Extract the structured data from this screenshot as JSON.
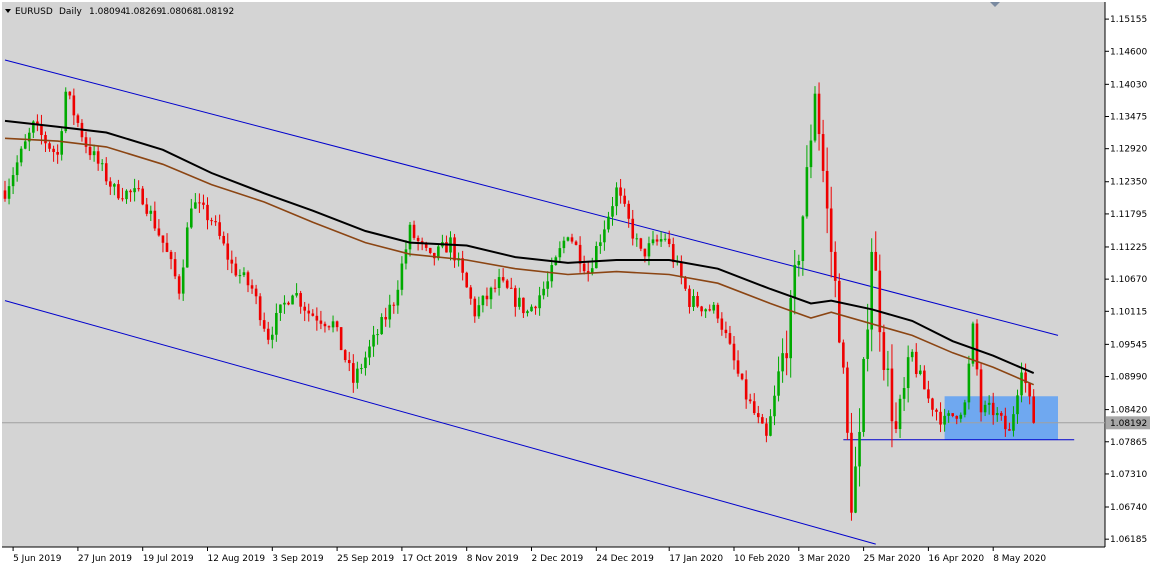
{
  "chart_data": {
    "type": "candlestick",
    "symbol": "EURUSD",
    "timeframe": "Daily",
    "ohlc_last": {
      "open": "1.08094",
      "high": "1.08269",
      "low": "1.08068",
      "close": "1.08192"
    },
    "current_price_label": "1.08192",
    "current_price": 1.08192,
    "ylim": [
      1.0605,
      1.1545
    ],
    "yticks": [
      "1.15155",
      "1.14600",
      "1.14030",
      "1.13475",
      "1.12920",
      "1.12350",
      "1.11795",
      "1.11225",
      "1.10670",
      "1.10115",
      "1.09545",
      "1.08990",
      "1.08420",
      "1.07865",
      "1.07310",
      "1.06740",
      "1.06185"
    ],
    "xticks": [
      {
        "label": "5 Jun 2019",
        "date": "2019-06-05"
      },
      {
        "label": "27 Jun 2019",
        "date": "2019-06-27"
      },
      {
        "label": "19 Jul 2019",
        "date": "2019-07-19"
      },
      {
        "label": "12 Aug 2019",
        "date": "2019-08-12"
      },
      {
        "label": "3 Sep 2019",
        "date": "2019-09-03"
      },
      {
        "label": "25 Sep 2019",
        "date": "2019-09-25"
      },
      {
        "label": "17 Oct 2019",
        "date": "2019-10-17"
      },
      {
        "label": "8 Nov 2019",
        "date": "2019-11-08"
      },
      {
        "label": "2 Dec 2019",
        "date": "2019-12-02"
      },
      {
        "label": "24 Dec 2019",
        "date": "2019-12-24"
      },
      {
        "label": "17 Jan 2020",
        "date": "2020-01-17"
      },
      {
        "label": "10 Feb 2020",
        "date": "2020-02-10"
      },
      {
        "label": "3 Mar 2020",
        "date": "2020-03-03"
      },
      {
        "label": "25 Mar 2020",
        "date": "2020-03-25"
      },
      {
        "label": "16 Apr 2020",
        "date": "2020-04-16"
      },
      {
        "label": "8 May 2020",
        "date": "2020-05-08"
      }
    ],
    "close_path": [
      [
        "2019-06-03",
        1.122
      ],
      [
        "2019-06-12",
        1.133
      ],
      [
        "2019-06-20",
        1.128
      ],
      [
        "2019-06-24",
        1.139
      ],
      [
        "2019-07-01",
        1.13
      ],
      [
        "2019-07-10",
        1.122
      ],
      [
        "2019-07-19",
        1.121
      ],
      [
        "2019-07-26",
        1.113
      ],
      [
        "2019-08-01",
        1.105
      ],
      [
        "2019-08-06",
        1.12
      ],
      [
        "2019-08-13",
        1.117
      ],
      [
        "2019-08-20",
        1.109
      ],
      [
        "2019-08-27",
        1.105
      ],
      [
        "2019-09-02",
        1.097
      ],
      [
        "2019-09-10",
        1.105
      ],
      [
        "2019-09-16",
        1.101
      ],
      [
        "2019-09-24",
        1.099
      ],
      [
        "2019-10-01",
        1.089
      ],
      [
        "2019-10-08",
        1.096
      ],
      [
        "2019-10-15",
        1.103
      ],
      [
        "2019-10-21",
        1.115
      ],
      [
        "2019-10-28",
        1.11
      ],
      [
        "2019-11-04",
        1.113
      ],
      [
        "2019-11-12",
        1.101
      ],
      [
        "2019-11-20",
        1.106
      ],
      [
        "2019-11-29",
        1.101
      ],
      [
        "2019-12-06",
        1.106
      ],
      [
        "2019-12-13",
        1.115
      ],
      [
        "2019-12-20",
        1.108
      ],
      [
        "2019-12-31",
        1.122
      ],
      [
        "2020-01-08",
        1.111
      ],
      [
        "2020-01-16",
        1.114
      ],
      [
        "2020-01-24",
        1.103
      ],
      [
        "2020-02-04",
        1.101
      ],
      [
        "2020-02-12",
        1.088
      ],
      [
        "2020-02-20",
        1.079
      ],
      [
        "2020-02-28",
        1.1
      ],
      [
        "2020-03-05",
        1.124
      ],
      [
        "2020-03-09",
        1.14
      ],
      [
        "2020-03-12",
        1.118
      ],
      [
        "2020-03-17",
        1.099
      ],
      [
        "2020-03-20",
        1.069
      ],
      [
        "2020-03-24",
        1.078
      ],
      [
        "2020-03-27",
        1.113
      ],
      [
        "2020-04-01",
        1.094
      ],
      [
        "2020-04-06",
        1.08
      ],
      [
        "2020-04-10",
        1.093
      ],
      [
        "2020-04-16",
        1.086
      ],
      [
        "2020-04-22",
        1.082
      ],
      [
        "2020-04-29",
        1.085
      ],
      [
        "2020-05-01",
        1.098
      ],
      [
        "2020-05-05",
        1.084
      ],
      [
        "2020-05-08",
        1.084
      ],
      [
        "2020-05-14",
        1.08
      ],
      [
        "2020-05-19",
        1.092
      ],
      [
        "2020-05-22",
        1.0819
      ]
    ],
    "series": [
      {
        "kind": "moving-average",
        "color": "#000000",
        "values": [
          [
            "2019-06-03",
            1.134
          ],
          [
            "2019-06-20",
            1.133
          ],
          [
            "2019-07-08",
            1.132
          ],
          [
            "2019-07-26",
            1.129
          ],
          [
            "2019-08-13",
            1.125
          ],
          [
            "2019-08-30",
            1.1215
          ],
          [
            "2019-09-17",
            1.1185
          ],
          [
            "2019-10-04",
            1.115
          ],
          [
            "2019-10-21",
            1.113
          ],
          [
            "2019-11-08",
            1.1125
          ],
          [
            "2019-11-26",
            1.1105
          ],
          [
            "2019-12-13",
            1.1095
          ],
          [
            "2019-12-31",
            1.11
          ],
          [
            "2020-01-17",
            1.11
          ],
          [
            "2020-02-04",
            1.1085
          ],
          [
            "2020-02-21",
            1.105
          ],
          [
            "2020-03-06",
            1.1025
          ],
          [
            "2020-03-13",
            1.103
          ],
          [
            "2020-03-27",
            1.1015
          ],
          [
            "2020-04-10",
            1.0995
          ],
          [
            "2020-04-24",
            1.096
          ],
          [
            "2020-05-08",
            1.0935
          ],
          [
            "2020-05-22",
            1.0905
          ]
        ]
      },
      {
        "kind": "moving-average",
        "color": "#8b4513",
        "values": [
          [
            "2019-06-03",
            1.131
          ],
          [
            "2019-06-20",
            1.1305
          ],
          [
            "2019-07-08",
            1.1295
          ],
          [
            "2019-07-26",
            1.1265
          ],
          [
            "2019-08-13",
            1.123
          ],
          [
            "2019-08-30",
            1.12
          ],
          [
            "2019-09-17",
            1.1165
          ],
          [
            "2019-10-04",
            1.113
          ],
          [
            "2019-10-21",
            1.111
          ],
          [
            "2019-11-08",
            1.11
          ],
          [
            "2019-11-26",
            1.1085
          ],
          [
            "2019-12-13",
            1.1075
          ],
          [
            "2019-12-31",
            1.108
          ],
          [
            "2020-01-17",
            1.1075
          ],
          [
            "2020-02-04",
            1.106
          ],
          [
            "2020-02-21",
            1.1025
          ],
          [
            "2020-03-06",
            1.1
          ],
          [
            "2020-03-13",
            1.101
          ],
          [
            "2020-03-27",
            1.099
          ],
          [
            "2020-04-10",
            1.097
          ],
          [
            "2020-04-24",
            1.094
          ],
          [
            "2020-05-08",
            1.0915
          ],
          [
            "2020-05-22",
            1.0885
          ]
        ]
      }
    ],
    "trendlines": [
      {
        "color": "#0000cc",
        "from": [
          "2019-06-03",
          1.1445
        ],
        "to": [
          "2020-05-31",
          1.097
        ]
      },
      {
        "color": "#0000cc",
        "from": [
          "2019-06-03",
          1.103
        ],
        "to": [
          "2020-03-29",
          1.061
        ]
      },
      {
        "color": "#0000cc",
        "from": [
          "2020-03-18",
          1.079
        ],
        "to": [
          "2020-06-05",
          1.079
        ]
      }
    ],
    "zone": {
      "color": "#6fa8f0",
      "from_date": "2020-04-22",
      "to_date": "2020-05-31",
      "y_low": 1.079,
      "y_high": 1.0865
    },
    "colors": {
      "background": "#d4d4d4",
      "bull": "#00aa00",
      "bear": "#ee0000",
      "grid_line": "#a0a0a0",
      "price_label_bg": "#a8a8a8"
    }
  }
}
